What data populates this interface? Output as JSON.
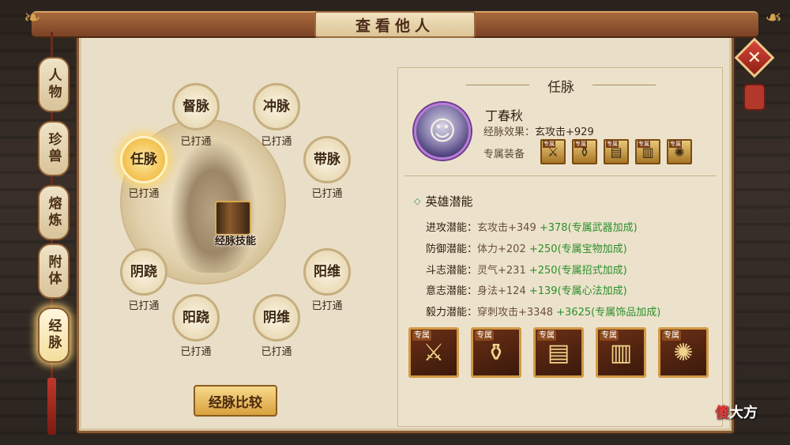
{
  "window": {
    "title": "查看他人"
  },
  "tabs": [
    {
      "label": "人物",
      "active": false
    },
    {
      "label": "珍兽",
      "active": false
    },
    {
      "label": "熔炼",
      "active": false
    },
    {
      "label": "附体",
      "active": false
    },
    {
      "label": "经脉",
      "active": true
    }
  ],
  "meridians": {
    "nodes": [
      {
        "name": "督脉",
        "status": "已打通",
        "active": false
      },
      {
        "name": "冲脉",
        "status": "已打通",
        "active": false
      },
      {
        "name": "任脉",
        "status": "已打通",
        "active": true
      },
      {
        "name": "带脉",
        "status": "已打通",
        "active": false
      },
      {
        "name": "阴跷",
        "status": "已打通",
        "active": false
      },
      {
        "name": "阳维",
        "status": "已打通",
        "active": false
      },
      {
        "name": "阳跷",
        "status": "已打通",
        "active": false
      },
      {
        "name": "阴维",
        "status": "已打通",
        "active": false
      }
    ],
    "skill_label": "经脉技能",
    "compare_button": "经脉比较"
  },
  "detail": {
    "title": "任脉",
    "hero_name": "丁春秋",
    "effect_label": "经脉效果：",
    "effect_value": "玄攻击+929",
    "equip_label": "专属装备",
    "section_title": "英雄潜能",
    "stats": [
      {
        "label": "进攻潜能：",
        "base": "玄攻击+349",
        "bonus_value": "+378",
        "bonus_text": "(专属武器加成)"
      },
      {
        "label": "防御潜能：",
        "base": "体力+202",
        "bonus_value": "+250",
        "bonus_text": "(专属宝物加成)"
      },
      {
        "label": "斗志潜能：",
        "base": "灵气+231",
        "bonus_value": "+250",
        "bonus_text": "(专属招式加成)"
      },
      {
        "label": "意志潜能：",
        "base": "身法+124",
        "bonus_value": "+139",
        "bonus_text": "(专属心法加成)"
      },
      {
        "label": "毅力潜能：",
        "base": "穿刺攻击+3348",
        "bonus_value": "+3625",
        "bonus_text": "(专属饰品加成)"
      }
    ],
    "equip_tag": "专属",
    "equipment": [
      {
        "icon": "weapon-icon"
      },
      {
        "icon": "treasure-icon"
      },
      {
        "icon": "skill-book-icon"
      },
      {
        "icon": "mind-book-icon"
      },
      {
        "icon": "accessory-icon"
      }
    ]
  },
  "watermark": {
    "red": "傻",
    "rest": "大方"
  },
  "colors": {
    "bonus_green": "#2c8f2c",
    "active_gold": "#f2c04c",
    "panel_bg": "#e9dfc8"
  }
}
